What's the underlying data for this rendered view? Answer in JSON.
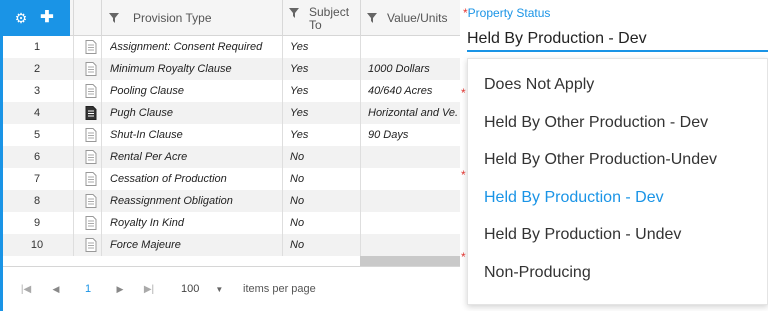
{
  "grid": {
    "columns": {
      "provision_type": "Provision Type",
      "subject_to": "Subject To",
      "value_units": "Value/Units"
    },
    "rows": [
      {
        "num": "1",
        "type": "Assignment: Consent Required",
        "subject": "Yes",
        "value": ""
      },
      {
        "num": "2",
        "type": "Minimum Royalty Clause",
        "subject": "Yes",
        "value": "1000 Dollars"
      },
      {
        "num": "3",
        "type": "Pooling Clause",
        "subject": "Yes",
        "value": "40/640 Acres"
      },
      {
        "num": "4",
        "type": "Pugh Clause",
        "subject": "Yes",
        "value": "Horizontal and Ve..."
      },
      {
        "num": "5",
        "type": "Shut-In Clause",
        "subject": "Yes",
        "value": "90 Days"
      },
      {
        "num": "6",
        "type": "Rental Per Acre",
        "subject": "No",
        "value": ""
      },
      {
        "num": "7",
        "type": "Cessation of Production",
        "subject": "No",
        "value": ""
      },
      {
        "num": "8",
        "type": "Reassignment Obligation",
        "subject": "No",
        "value": ""
      },
      {
        "num": "9",
        "type": "Royalty In Kind",
        "subject": "No",
        "value": ""
      },
      {
        "num": "10",
        "type": "Force Majeure",
        "subject": "No",
        "value": ""
      }
    ],
    "pager": {
      "current_page": "1",
      "page_size": "100",
      "items_per_page_label": "items per page"
    }
  },
  "property_status": {
    "label": "Property Status",
    "required_mark": "*",
    "value": "Held By Production - Dev",
    "options": [
      "Does Not Apply",
      "Held By Other Production - Dev",
      "Held By Other Production-Undev",
      "Held By Production - Dev",
      "Held By Production - Undev",
      "Non-Producing"
    ],
    "selected_index": 3
  },
  "colors": {
    "accent": "#1a94e6",
    "required": "#e53935",
    "row_alt": "#f2f2f2"
  },
  "icons": {
    "settings": "gear-icon",
    "add": "plus-icon",
    "filter": "filter-icon",
    "document": "document-icon"
  }
}
